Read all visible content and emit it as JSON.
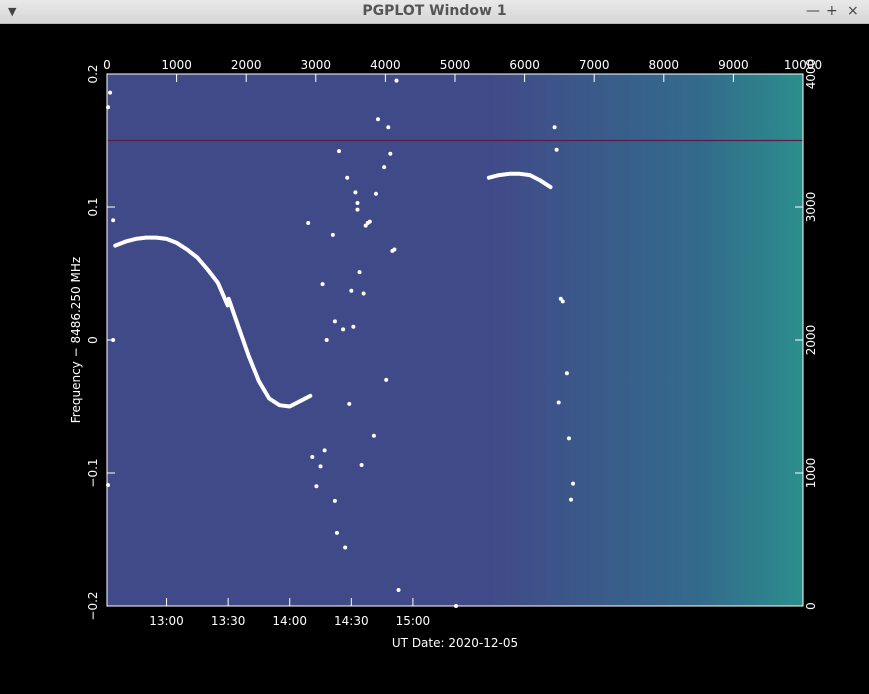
{
  "window": {
    "title": "PGPLOT Window 1",
    "controls": {
      "minimize": "—",
      "maximize": "+",
      "close": "×"
    }
  },
  "colors": {
    "background": "#000000",
    "plot_left": "#414a88",
    "plot_right": "#2b8e8c",
    "tracks": "#ffffff",
    "line": "#5a1a4a"
  },
  "chart_data": {
    "type": "scatter",
    "xlabel": "UT Date: 2020-12-05",
    "ylabel": "Frequency − 8486.250 MHz",
    "xlim_minutes": [
      751,
      1090
    ],
    "x_ticks": [
      {
        "t": 780,
        "label": "13:00"
      },
      {
        "t": 810,
        "label": "13:30"
      },
      {
        "t": 840,
        "label": "14:00"
      },
      {
        "t": 870,
        "label": "14:30"
      },
      {
        "t": 900,
        "label": "15:00"
      }
    ],
    "ylim": [
      -0.2,
      0.2
    ],
    "y_ticks": [
      {
        "v": -0.2,
        "label": "−0.2"
      },
      {
        "v": -0.1,
        "label": "−0.1"
      },
      {
        "v": 0,
        "label": "0"
      },
      {
        "v": 0.1,
        "label": "0.1"
      },
      {
        "v": 0.2,
        "label": "0.2"
      }
    ],
    "top_axis": {
      "lim": [
        0,
        10000
      ],
      "ticks": [
        0,
        1000,
        2000,
        3000,
        4000,
        5000,
        6000,
        7000,
        8000,
        9000,
        10000
      ],
      "labels": [
        "0",
        "1000",
        "2000",
        "3000",
        "4000",
        "5000",
        "6000",
        "7000",
        "8000",
        "9000",
        "10000"
      ]
    },
    "right_axis": {
      "lim": [
        0,
        4000
      ],
      "ticks": [
        0,
        1000,
        2000,
        3000,
        4000
      ],
      "labels": [
        "0",
        "1000",
        "2000",
        "3000",
        "4000"
      ]
    },
    "horizontal_line": {
      "y": 0.15
    },
    "tracks": [
      {
        "name": "",
        "points": [
          [
            755,
            0.071
          ],
          [
            760,
            0.074
          ],
          [
            765,
            0.076
          ],
          [
            770,
            0.077
          ],
          [
            775,
            0.077
          ],
          [
            780,
            0.076
          ],
          [
            785,
            0.073
          ],
          [
            790,
            0.068
          ],
          [
            795,
            0.062
          ],
          [
            800,
            0.053
          ],
          [
            805,
            0.043
          ],
          [
            809.8,
            0.026
          ]
        ]
      },
      {
        "name": "",
        "points": [
          [
            810.3,
            0.031
          ],
          [
            815,
            0.01
          ],
          [
            820,
            -0.012
          ],
          [
            825,
            -0.031
          ],
          [
            830,
            -0.044
          ],
          [
            835,
            -0.049
          ],
          [
            840,
            -0.05
          ],
          [
            845,
            -0.046
          ],
          [
            850,
            -0.042
          ]
        ]
      },
      {
        "name": "",
        "points": [
          [
            937,
            0.122
          ],
          [
            942,
            0.124
          ],
          [
            947,
            0.125
          ],
          [
            952,
            0.125
          ],
          [
            957,
            0.124
          ],
          [
            962,
            0.12
          ],
          [
            967,
            0.115
          ]
        ]
      }
    ],
    "scatter": [
      [
        751.5,
        0.175
      ],
      [
        752.5,
        0.186
      ],
      [
        754,
        0.09
      ],
      [
        754,
        0.0
      ],
      [
        751.5,
        -0.109
      ],
      [
        849,
        0.088
      ],
      [
        851,
        -0.088
      ],
      [
        853,
        -0.11
      ],
      [
        855,
        -0.095
      ],
      [
        856,
        0.042
      ],
      [
        857,
        -0.083
      ],
      [
        858,
        0.0
      ],
      [
        861,
        0.079
      ],
      [
        862,
        0.014
      ],
      [
        864,
        0.142
      ],
      [
        866,
        0.008
      ],
      [
        868,
        0.122
      ],
      [
        869,
        -0.048
      ],
      [
        870,
        0.037
      ],
      [
        871,
        0.01
      ],
      [
        872,
        0.111
      ],
      [
        873,
        0.103
      ],
      [
        873,
        0.098
      ],
      [
        874,
        0.051
      ],
      [
        875,
        -0.094
      ],
      [
        876,
        0.035
      ],
      [
        877,
        0.086
      ],
      [
        878,
        0.088
      ],
      [
        879,
        0.089
      ],
      [
        881,
        -0.072
      ],
      [
        882,
        0.11
      ],
      [
        883,
        0.166
      ],
      [
        886,
        0.13
      ],
      [
        887,
        -0.03
      ],
      [
        888,
        0.16
      ],
      [
        889,
        0.14
      ],
      [
        890,
        0.067
      ],
      [
        891,
        0.068
      ],
      [
        892,
        0.195
      ],
      [
        893,
        -0.188
      ],
      [
        863,
        -0.145
      ],
      [
        862,
        -0.121
      ],
      [
        867,
        -0.156
      ],
      [
        921,
        -0.2
      ],
      [
        969,
        0.16
      ],
      [
        970,
        0.143
      ],
      [
        971,
        -0.047
      ],
      [
        972,
        0.031
      ],
      [
        973,
        0.029
      ],
      [
        975,
        -0.025
      ],
      [
        976,
        -0.074
      ],
      [
        977,
        -0.12
      ],
      [
        978,
        -0.108
      ]
    ]
  }
}
